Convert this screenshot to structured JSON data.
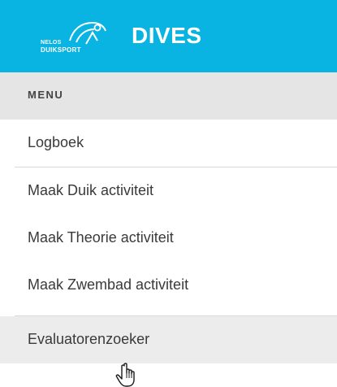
{
  "header": {
    "logo_line1": "NELOS",
    "logo_line2": "DUIKSPORT",
    "title": "DIVES",
    "background_color": "#0ab4e2",
    "logo_icon": "diver-logo-icon"
  },
  "menu": {
    "heading": "MENU",
    "items": [
      {
        "label": "Logboek",
        "active": false
      },
      {
        "label": "Maak Duik activiteit",
        "active": false
      },
      {
        "label": "Maak Theorie activiteit",
        "active": false
      },
      {
        "label": "Maak Zwembad activiteit",
        "active": false
      },
      {
        "label": "Evaluatorenzoeker",
        "active": true
      }
    ]
  },
  "cursor": {
    "icon": "hand-pointer-icon"
  }
}
